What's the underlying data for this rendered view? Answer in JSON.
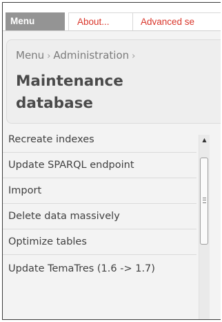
{
  "tabs": {
    "menu": "Menu",
    "about": "About...",
    "advanced": "Advanced se"
  },
  "breadcrumb": {
    "items": [
      "Menu",
      "Administration"
    ],
    "separator": "›"
  },
  "page_title": "Maintenance database",
  "menu_items": [
    "Recreate indexes",
    "Update SPARQL endpoint",
    "Import",
    "Delete data massively",
    "Optimize tables",
    "Update TemaTres (1.6 -> 1.7)"
  ],
  "scrollbar": {
    "up_arrow": "▲",
    "position": 0.0
  },
  "colors": {
    "active_tab_bg": "#949494",
    "link_red": "#d9352a",
    "panel_bg": "#eeeeee",
    "text": "#404040"
  }
}
